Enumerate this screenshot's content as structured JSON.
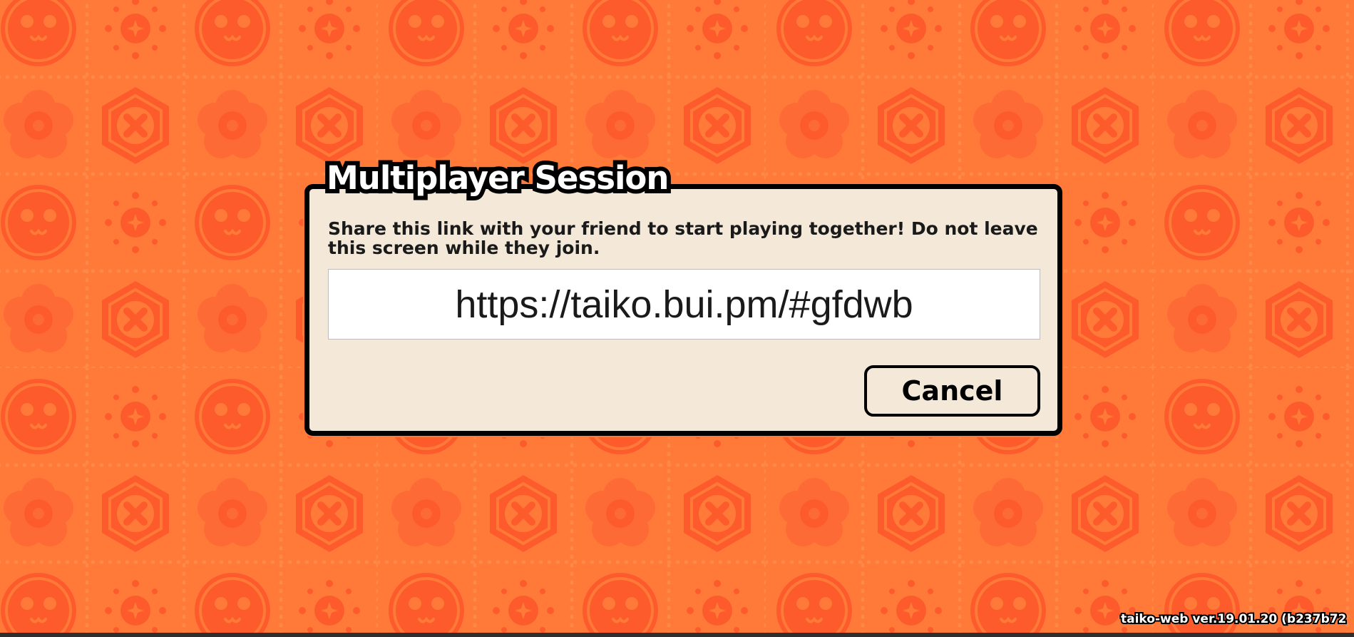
{
  "dialog": {
    "title": "Multiplayer Session",
    "message": "Share this link with your friend to start playing together! Do not leave this screen while they join.",
    "link": "https://taiko.bui.pm/#gfdwb",
    "cancel_label": "Cancel"
  },
  "footer": {
    "version": "taiko-web ver.19.01.20 (b237b72"
  },
  "colors": {
    "background": "#ff7a38",
    "pattern": "#fe5b2c",
    "dialog": "#f4e9d9",
    "border": "#000000"
  },
  "background_icons": [
    "smiling-drum-icon",
    "sparkle-dot-icon",
    "plum-flower-icon",
    "hexagon-crest-icon"
  ]
}
